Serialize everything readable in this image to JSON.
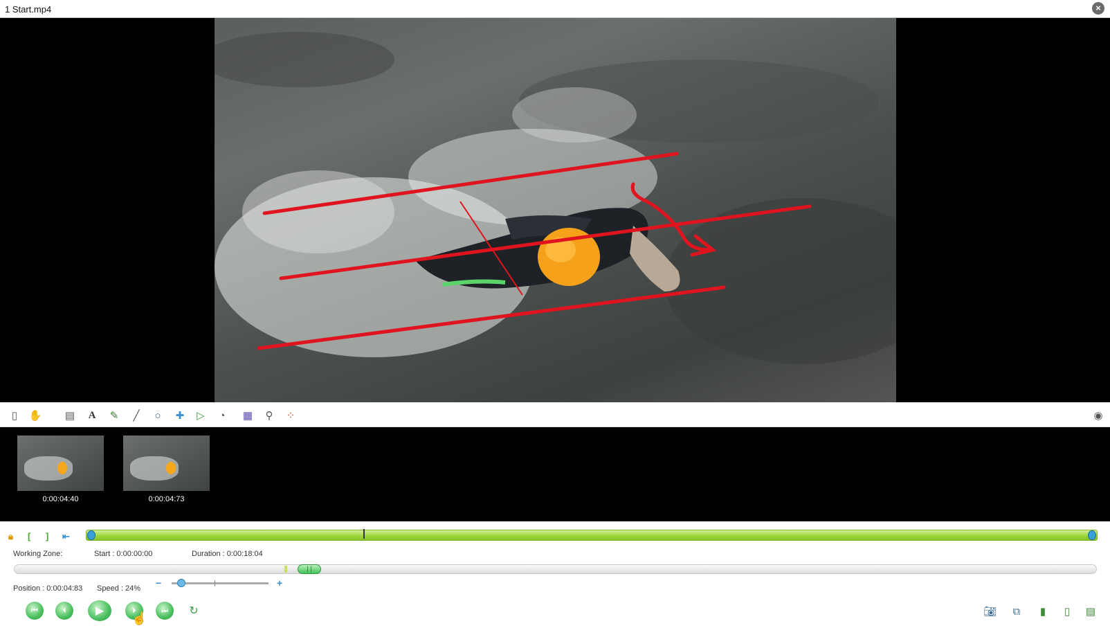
{
  "window": {
    "title": "1 Start.mp4",
    "close_icon": "close-icon"
  },
  "toolbar": {
    "tools": [
      "new-key-image-icon",
      "hand-tool-icon",
      "drawing-pad-icon",
      "text-tool-icon",
      "pencil-tool-icon",
      "line-tool-icon",
      "circle-tool-icon",
      "cross-marker-icon",
      "angle-tool-icon",
      "chronometer-icon",
      "grid-perspective-icon",
      "magnifier-icon",
      "color-grid-icon"
    ],
    "right_icon": "options-icon"
  },
  "keyframes": [
    {
      "time": "0:00:04:40"
    },
    {
      "time": "0:00:04:73"
    }
  ],
  "working_zone": {
    "label": "Working Zone:",
    "start": "Start : 0:00:00:00",
    "duration": "Duration : 0:00:18:04"
  },
  "playback": {
    "position": "Position : 0:00:04:83",
    "speed": "Speed : 24%",
    "speed_percent": 24,
    "speed_minus": "−",
    "speed_plus": "+",
    "position_fraction": 0.266,
    "thumb_label": "| |"
  },
  "colors": {
    "zone_green": "#9fd63c",
    "annotation_red": "#e0141e",
    "accent_blue": "#3aa0d8"
  }
}
